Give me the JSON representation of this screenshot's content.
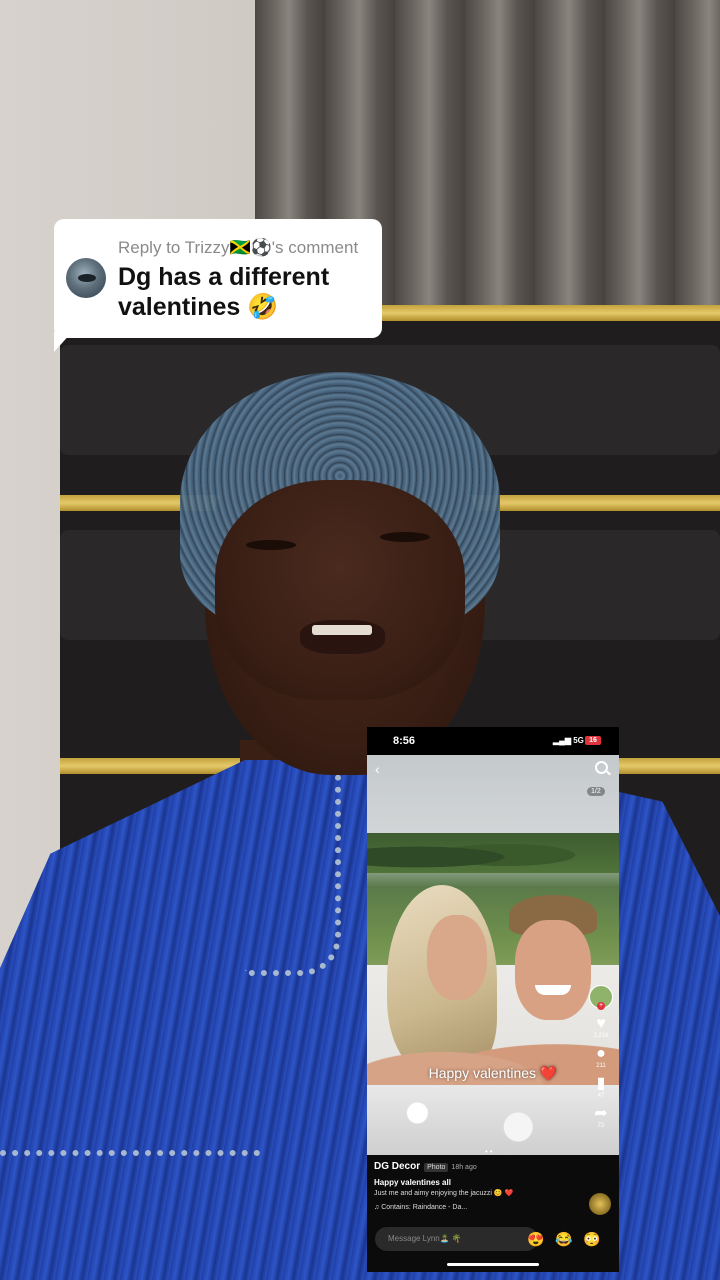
{
  "reply_sticker": {
    "meta": "Reply to Trizzy🇯🇲⚽'s comment",
    "comment": "Dg has a different valentines 🤣"
  },
  "embedded_phone": {
    "status_bar": {
      "time": "8:56",
      "network": "5G",
      "battery": "16"
    },
    "photo_counter": "1/2",
    "photo_caption": "Happy valentines",
    "caption_emoji": "❤️",
    "side_rail": {
      "likes": "2,216",
      "comments": "211",
      "saves": "47",
      "shares": "72"
    },
    "post": {
      "author": "DG Decor",
      "type_badge": "Photo",
      "time_ago": "18h ago",
      "title": "Happy valentines all",
      "description": "Just me and aimy enjoying the jacuzzi 😊 ❤️",
      "music": "♫ Contains: Raindance - Da..."
    },
    "message_placeholder": "Message Lynn🏝️ 🌴",
    "quick_emojis": [
      "😍",
      "😂",
      "😳"
    ],
    "icons": [
      "back-icon",
      "search-icon",
      "heart-icon",
      "comment-icon",
      "bookmark-icon",
      "share-icon",
      "music-disc-icon"
    ]
  },
  "colors": {
    "reply_bg": "#ffffff",
    "accent_red": "#e0333c",
    "robe_blue": "#2a4fc0"
  }
}
